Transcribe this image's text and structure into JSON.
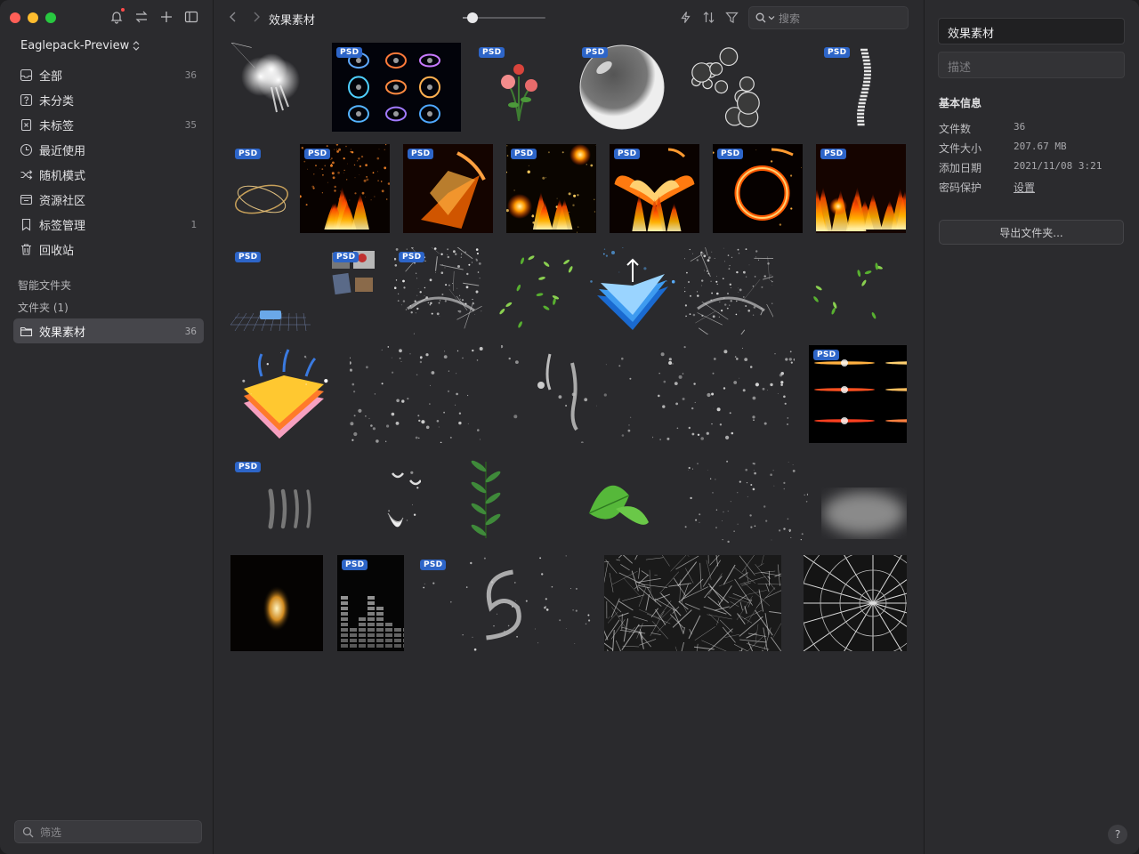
{
  "sidebar": {
    "library_name": "Eaglepack-Preview",
    "nav": [
      {
        "label": "全部",
        "count": "36",
        "icon": "inbox-icon"
      },
      {
        "label": "未分类",
        "count": "",
        "icon": "question-box-icon"
      },
      {
        "label": "未标签",
        "count": "35",
        "icon": "untagged-icon"
      },
      {
        "label": "最近使用",
        "count": "",
        "icon": "clock-icon"
      },
      {
        "label": "随机模式",
        "count": "",
        "icon": "shuffle-icon"
      },
      {
        "label": "资源社区",
        "count": "",
        "icon": "community-icon"
      },
      {
        "label": "标签管理",
        "count": "1",
        "icon": "bookmark-icon"
      },
      {
        "label": "回收站",
        "count": "",
        "icon": "trash-icon"
      }
    ],
    "smart_folders_label": "智能文件夹",
    "folders_label": "文件夹 (1)",
    "active_folder": {
      "label": "效果素材",
      "count": "36"
    },
    "filter_placeholder": "筛选"
  },
  "toolbar": {
    "title": "效果素材",
    "zoom_fraction": 0.12,
    "search_placeholder": "搜索"
  },
  "grid": {
    "psd_badge": "PSD",
    "items": [
      {
        "kind": "smoke-cloud",
        "psd": false
      },
      {
        "kind": "light-rings",
        "psd": true
      },
      {
        "kind": "flowers",
        "psd": true
      },
      {
        "kind": "bubble",
        "psd": true
      },
      {
        "kind": "bubbles",
        "psd": false
      },
      {
        "kind": "spine-curve",
        "psd": true
      },
      {
        "kind": "gold-rings",
        "psd": true
      },
      {
        "kind": "fire-sparks",
        "psd": true
      },
      {
        "kind": "fire-box",
        "psd": true
      },
      {
        "kind": "fire-stars",
        "psd": true
      },
      {
        "kind": "fire-phoenix",
        "psd": true
      },
      {
        "kind": "fire-ring",
        "psd": true
      },
      {
        "kind": "fire-flames",
        "psd": true
      },
      {
        "kind": "grid-floor",
        "psd": true
      },
      {
        "kind": "collage",
        "psd": true
      },
      {
        "kind": "water-splash",
        "psd": true
      },
      {
        "kind": "green-leaves",
        "psd": false
      },
      {
        "kind": "blue-layers",
        "psd": false
      },
      {
        "kind": "water-splash-2",
        "psd": false
      },
      {
        "kind": "leaves-scatter",
        "psd": false
      },
      {
        "kind": "color-layers",
        "psd": false
      },
      {
        "kind": "water-drops",
        "psd": false
      },
      {
        "kind": "ink-drops",
        "psd": false
      },
      {
        "kind": "water-drops-2",
        "psd": false
      },
      {
        "kind": "lens-flares",
        "psd": true
      },
      {
        "kind": "ink-strokes",
        "psd": true
      },
      {
        "kind": "feathers",
        "psd": false
      },
      {
        "kind": "leaf-branch",
        "psd": false
      },
      {
        "kind": "green-leaf",
        "psd": false
      },
      {
        "kind": "dust-particles",
        "psd": false
      },
      {
        "kind": "fog",
        "psd": false
      },
      {
        "kind": "light-beam",
        "psd": false
      },
      {
        "kind": "equalizer",
        "psd": true
      },
      {
        "kind": "water-swirl",
        "psd": true
      },
      {
        "kind": "cracked-glass",
        "psd": false
      },
      {
        "kind": "shattered-glass",
        "psd": false
      },
      {
        "kind": "feathers-2",
        "psd": false
      }
    ]
  },
  "inspector": {
    "name": "效果素材",
    "description_placeholder": "描述",
    "section_title": "基本信息",
    "rows": [
      {
        "key": "文件数",
        "value": "36"
      },
      {
        "key": "文件大小",
        "value": "207.67 MB"
      },
      {
        "key": "添加日期",
        "value": "2021/11/08 3:21"
      },
      {
        "key": "密码保护",
        "value": "设置"
      }
    ],
    "export_label": "导出文件夹...",
    "help_label": "?"
  },
  "colors": {
    "close": "#ff5f57",
    "minimize": "#febc2e",
    "zoom": "#28c840",
    "psd_badge": "#2d65c8",
    "active_folder_bg": "#46464b"
  }
}
